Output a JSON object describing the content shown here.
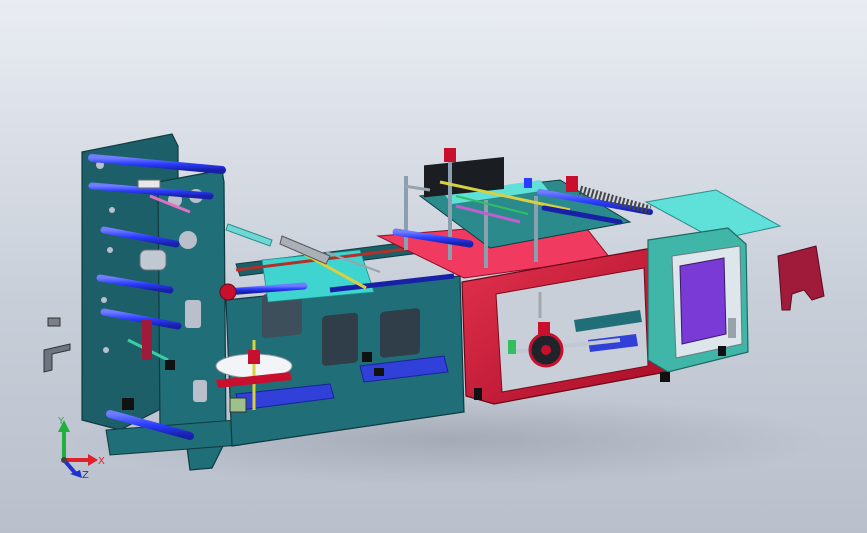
{
  "viewport": {
    "background_top": "#e9edf3",
    "background_bottom": "#b9c0cc"
  },
  "colors": {
    "frame_teal": "#1f6e78",
    "frame_dark": "#174f57",
    "roller_blue": "#2a3cff",
    "roller_dark": "#1820a8",
    "housing_red": "#c8102e",
    "housing_pink": "#f03a5f",
    "panel_cyan": "#3fd4d0",
    "panel_purple": "#7a3ad6",
    "cabinet_teal": "#3fb6a8",
    "part_magenta": "#a01a3a",
    "table_cyan": "#5fe0d8",
    "accent_yellow": "#d8d040",
    "accent_green": "#30c060"
  },
  "triad": {
    "x_label": "X",
    "y_label": "Y",
    "z_label": "Z",
    "x_color": "#e0202a",
    "y_color": "#20b040",
    "z_color": "#2030d0"
  }
}
